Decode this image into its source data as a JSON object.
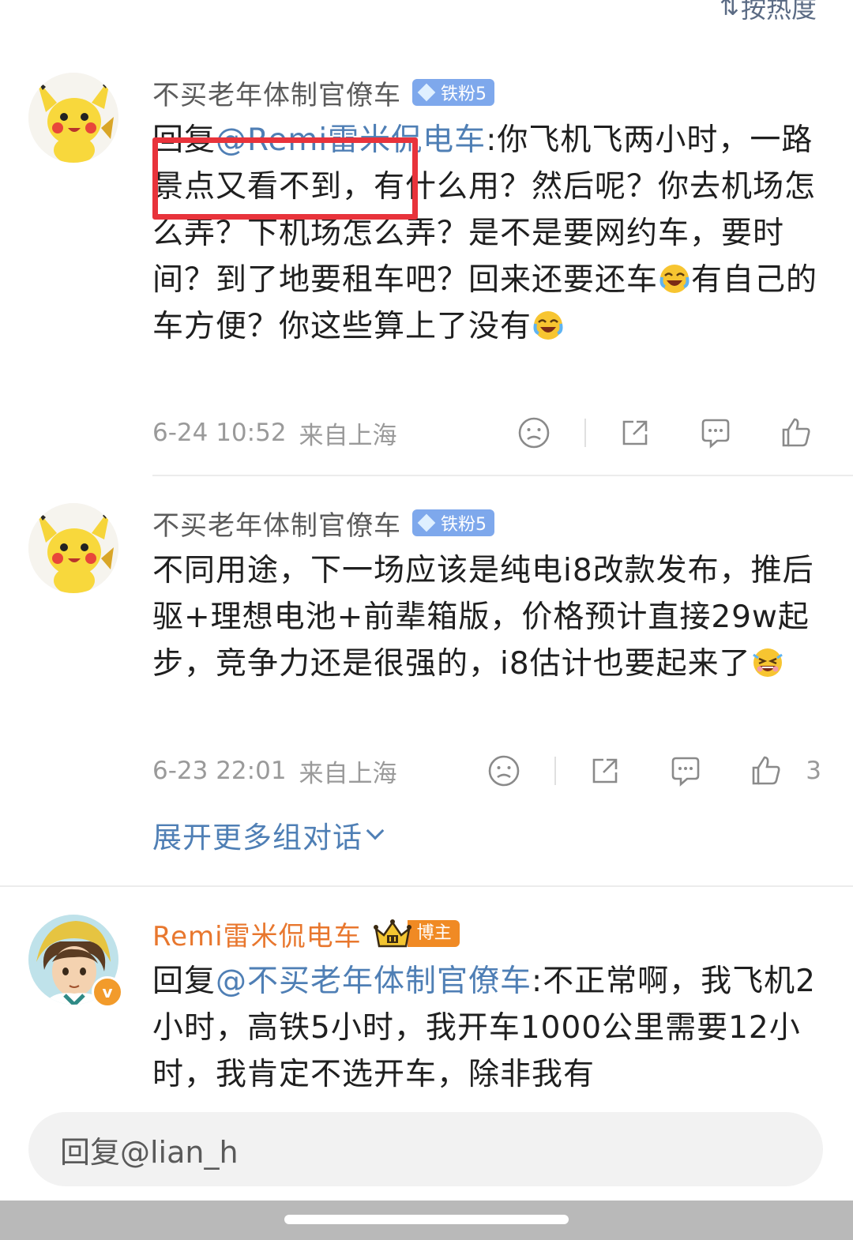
{
  "sort": {
    "label": "按热度"
  },
  "comments": [
    {
      "username": "不买老年体制官僚车",
      "fan_badge": "铁粉5",
      "reply_prefix": "回复",
      "mention": "@Remi雷米侃电车",
      "text": ":你飞机飞两小时，一路景点又看不到，有什么用？然后呢？你去机场怎么弄？下机场怎么弄？是不是要网约车，要时间？到了地要租车吧？回来还要还车",
      "text_after_emoji": "有自己的车方便？你这些算上了没有",
      "time": "6-24 10:52",
      "location": "来自上海",
      "like_count": ""
    },
    {
      "username": "不买老年体制官僚车",
      "fan_badge": "铁粉5",
      "text": "不同用途，下一场应该是纯电i8改款发布，推后驱+理想电池+前辈箱版，价格预计直接29w起步，竞争力还是很强的，i8估计也要起来了",
      "time": "6-23 22:01",
      "location": "来自上海",
      "like_count": "3"
    },
    {
      "username": "Remi雷米侃电车",
      "host_badge": "博主",
      "verified_mark": "v",
      "reply_prefix": "回复",
      "mention": "@不买老年体制官僚车",
      "text": ":不正常啊，我飞机2小时，高铁5小时，我开车1000公里需要12小时，我肯定不选开车，除非我有"
    }
  ],
  "expand_link": {
    "label": "展开更多组对话"
  },
  "reply_input": {
    "placeholder": "回复@lian_h"
  },
  "colors": {
    "mention": "#4f7fb5",
    "author_name": "#e8772e",
    "highlight": "#e8333b",
    "fan_badge": "#7ea8ec",
    "host_badge": "#f08a24"
  },
  "icons": [
    "sort-icon",
    "dislike-icon",
    "share-icon",
    "comment-icon",
    "like-icon",
    "laugh-cry-emoji",
    "grin-sweat-emoji",
    "crown-icon",
    "diamond-icon",
    "chevron-down-icon"
  ]
}
